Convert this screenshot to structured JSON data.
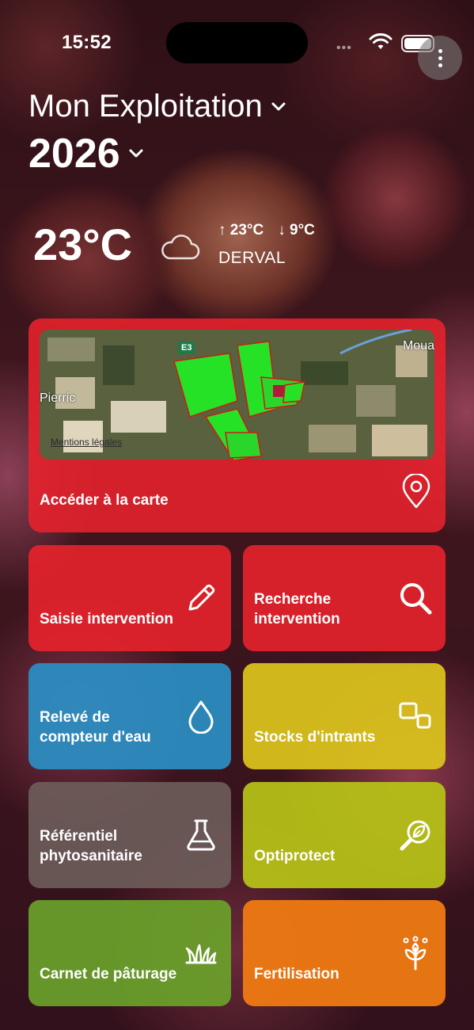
{
  "status_bar": {
    "time": "15:52",
    "signal_placeholder": "•••"
  },
  "header": {
    "farm_name": "Mon Exploitation",
    "year": "2026"
  },
  "weather": {
    "temperature": "23°C",
    "max_temp": "↑ 23°C",
    "min_temp": "↓ 9°C",
    "location": "DERVAL",
    "icon": "cloud-icon"
  },
  "map_card": {
    "west_place": "Pierric",
    "east_place": "Moua",
    "road_label": "E3",
    "legal_link": "Mentions légales",
    "cta_label": "Accéder à la carte",
    "icon": "map-pin-icon"
  },
  "tiles": [
    {
      "label": "Saisie intervention",
      "icon": "pencil-icon",
      "color": "#e8222c"
    },
    {
      "label": "Recherche intervention",
      "icon": "search-icon",
      "color": "#e8222c"
    },
    {
      "label": "Relevé de compteur d'eau",
      "icon": "water-drop-icon",
      "color": "#2a8fc4"
    },
    {
      "label": "Stocks d'intrants",
      "icon": "stocks-icon",
      "color": "#dcc51c"
    },
    {
      "label": "Référentiel phytosanitaire",
      "icon": "flask-icon",
      "color": "#6c5c5a"
    },
    {
      "label": "Optiprotect",
      "icon": "leaf-magnifier-icon",
      "color": "#b8c417"
    },
    {
      "label": "Carnet de pâturage",
      "icon": "grass-icon",
      "color": "#6aa22a"
    },
    {
      "label": "Fertilisation",
      "icon": "sprout-icon",
      "color": "#f07a12"
    }
  ]
}
